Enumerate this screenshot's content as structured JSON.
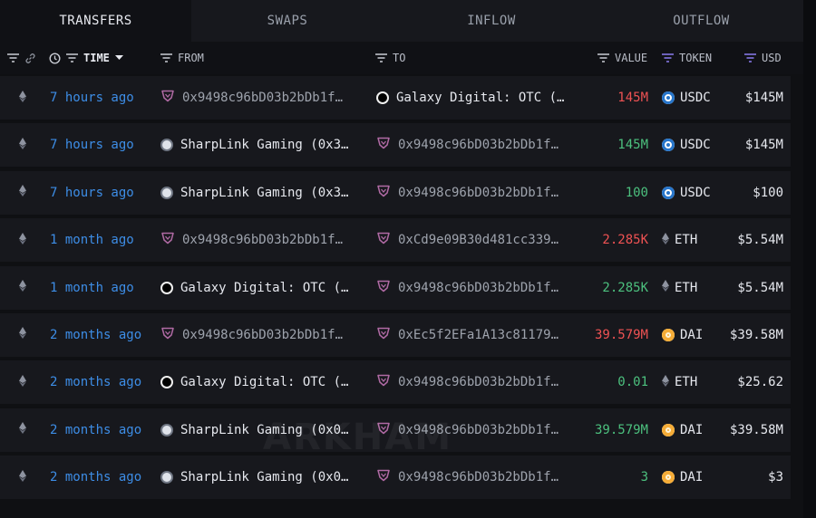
{
  "tabs": [
    {
      "label": "TRANSFERS",
      "active": true
    },
    {
      "label": "SWAPS",
      "active": false
    },
    {
      "label": "INFLOW",
      "active": false
    },
    {
      "label": "OUTFLOW",
      "active": false
    }
  ],
  "columns": {
    "time": "TIME",
    "from": "FROM",
    "to": "TO",
    "value": "VALUE",
    "token": "TOKEN",
    "usd": "USD"
  },
  "colors": {
    "accent_link": "#3d8de6",
    "inflow_value": "#4cc07e",
    "outflow_value": "#ee5253",
    "usdc": "#2775ca",
    "dai": "#f5ac37"
  },
  "rows": [
    {
      "chain_icon": "eth-icon",
      "time": "7 hours ago",
      "from": "0x9498c96bD03b2bDb1f…",
      "from_type": "address",
      "to": "Galaxy Digital: OTC (…",
      "to_type": "galaxy",
      "value": "145M",
      "direction": "out",
      "token": "USDC",
      "token_icon": "usdc-icon",
      "usd": "$145M"
    },
    {
      "chain_icon": "eth-icon",
      "time": "7 hours ago",
      "from": "SharpLink Gaming (0x3…",
      "from_type": "sharplink",
      "to": "0x9498c96bD03b2bDb1f…",
      "to_type": "address",
      "value": "145M",
      "direction": "in",
      "token": "USDC",
      "token_icon": "usdc-icon",
      "usd": "$145M"
    },
    {
      "chain_icon": "eth-icon",
      "time": "7 hours ago",
      "from": "SharpLink Gaming (0x3…",
      "from_type": "sharplink",
      "to": "0x9498c96bD03b2bDb1f…",
      "to_type": "address",
      "value": "100",
      "direction": "in",
      "token": "USDC",
      "token_icon": "usdc-icon",
      "usd": "$100"
    },
    {
      "chain_icon": "eth-icon",
      "time": "1 month ago",
      "from": "0x9498c96bD03b2bDb1f…",
      "from_type": "address",
      "to": "0xCd9e09B30d481cc339…",
      "to_type": "address",
      "value": "2.285K",
      "direction": "out",
      "token": "ETH",
      "token_icon": "eth-icon",
      "usd": "$5.54M"
    },
    {
      "chain_icon": "eth-icon",
      "time": "1 month ago",
      "from": "Galaxy Digital: OTC (…",
      "from_type": "galaxy",
      "to": "0x9498c96bD03b2bDb1f…",
      "to_type": "address",
      "value": "2.285K",
      "direction": "in",
      "token": "ETH",
      "token_icon": "eth-icon",
      "usd": "$5.54M"
    },
    {
      "chain_icon": "eth-icon",
      "time": "2 months ago",
      "from": "0x9498c96bD03b2bDb1f…",
      "from_type": "address",
      "to": "0xEc5f2EFa1A13c81179…",
      "to_type": "address",
      "value": "39.579M",
      "direction": "out",
      "token": "DAI",
      "token_icon": "dai-icon",
      "usd": "$39.58M"
    },
    {
      "chain_icon": "eth-icon",
      "time": "2 months ago",
      "from": "Galaxy Digital: OTC (…",
      "from_type": "galaxy",
      "to": "0x9498c96bD03b2bDb1f…",
      "to_type": "address",
      "value": "0.01",
      "direction": "in",
      "token": "ETH",
      "token_icon": "eth-icon",
      "usd": "$25.62"
    },
    {
      "chain_icon": "eth-icon",
      "time": "2 months ago",
      "from": "SharpLink Gaming (0x0…",
      "from_type": "sharplink",
      "to": "0x9498c96bD03b2bDb1f…",
      "to_type": "address",
      "value": "39.579M",
      "direction": "in",
      "token": "DAI",
      "token_icon": "dai-icon",
      "usd": "$39.58M"
    },
    {
      "chain_icon": "eth-icon",
      "time": "2 months ago",
      "from": "SharpLink Gaming (0x0…",
      "from_type": "sharplink",
      "to": "0x9498c96bD03b2bDb1f…",
      "to_type": "address",
      "value": "3",
      "direction": "in",
      "token": "DAI",
      "token_icon": "dai-icon",
      "usd": "$3"
    }
  ]
}
